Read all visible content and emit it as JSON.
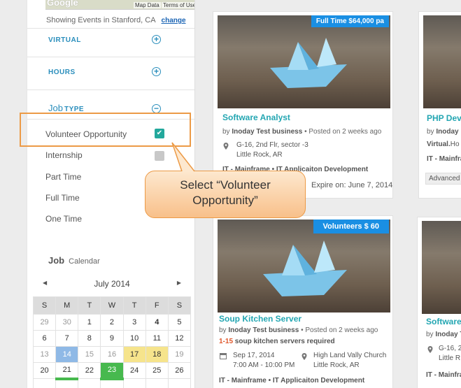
{
  "map": {
    "brand": "Google",
    "map_data": "Map Data",
    "terms": "Terms of Use"
  },
  "location": {
    "text": "Showing Events in Stanford, CA",
    "change": "change"
  },
  "filters": {
    "virtual": "VIRTUAL",
    "hours": "HOURS",
    "job_type_a": "Job",
    "job_type_b": "TYPE"
  },
  "job_types": [
    {
      "label": "Volunteer Opportunity",
      "checked": true
    },
    {
      "label": "Internship",
      "checked": false
    },
    {
      "label": "Part Time"
    },
    {
      "label": "Full Time"
    },
    {
      "label": "One Time"
    }
  ],
  "calendar": {
    "title_a": "Job",
    "title_b": "Calendar",
    "month": "July 2014",
    "days": [
      "S",
      "M",
      "T",
      "W",
      "T",
      "F",
      "S"
    ],
    "weeks": [
      [
        "29",
        "30",
        "1",
        "2",
        "3",
        "4",
        "5"
      ],
      [
        "6",
        "7",
        "8",
        "9",
        "10",
        "11",
        "12"
      ],
      [
        "13",
        "14",
        "15",
        "16",
        "17",
        "18",
        "19"
      ],
      [
        "20",
        "21",
        "22",
        "23",
        "24",
        "25",
        "26"
      ]
    ],
    "colors": {
      "blue": "#8fb9e6",
      "yellow": "#f6e48c",
      "green": "#47b94e"
    }
  },
  "callout": {
    "line1": "Select “Volunteer",
    "line2": "Opportunity”"
  },
  "cards": {
    "c1": {
      "tag": "Full Time $64,000 pa",
      "title": "Software Analyst",
      "by_prefix": "by",
      "org": "Inoday Test business",
      "posted": "Posted on 2 weeks ago",
      "addr1": "G-16, 2nd Flr, sector -3",
      "addr2": "Little Rock, AR",
      "cat1": "IT - Mainframe",
      "cat2": "IT Applicaiton Development",
      "expire": "Expire on: June 7, 2014"
    },
    "c2": {
      "title": "PHP Deve",
      "by_prefix": "by",
      "org": "Inoday",
      "virtual": "Virtual.",
      "virtual_rest": "Ho",
      "cat1": "IT - Mainfra",
      "adv": "Advanced"
    },
    "c3": {
      "tag": "Volunteers  $ 60",
      "title": "Soup Kitchen Server",
      "by_prefix": "by",
      "org": "Inoday Test business",
      "posted": "Posted on 2 weeks ago",
      "count": "1-15",
      "need": "soup kitchen servers required",
      "date": "Sep 17, 2014",
      "time": "7:00 AM - 10:00 PM",
      "place1": "High Land Vally Church",
      "place2": "Little Rock, AR",
      "cat1": "IT - Mainframe",
      "cat2": "IT Applicaiton Development"
    },
    "c4": {
      "title": "Software",
      "by_prefix": "by",
      "org": "Inoday T",
      "addr1": "G-16, 2n",
      "addr2": "Little R",
      "cat1": "IT - Mainfra"
    }
  },
  "accent": {
    "teal": "#23a6b2",
    "blue_tag": "#1a8fe3",
    "orange": "#ec9a46"
  }
}
